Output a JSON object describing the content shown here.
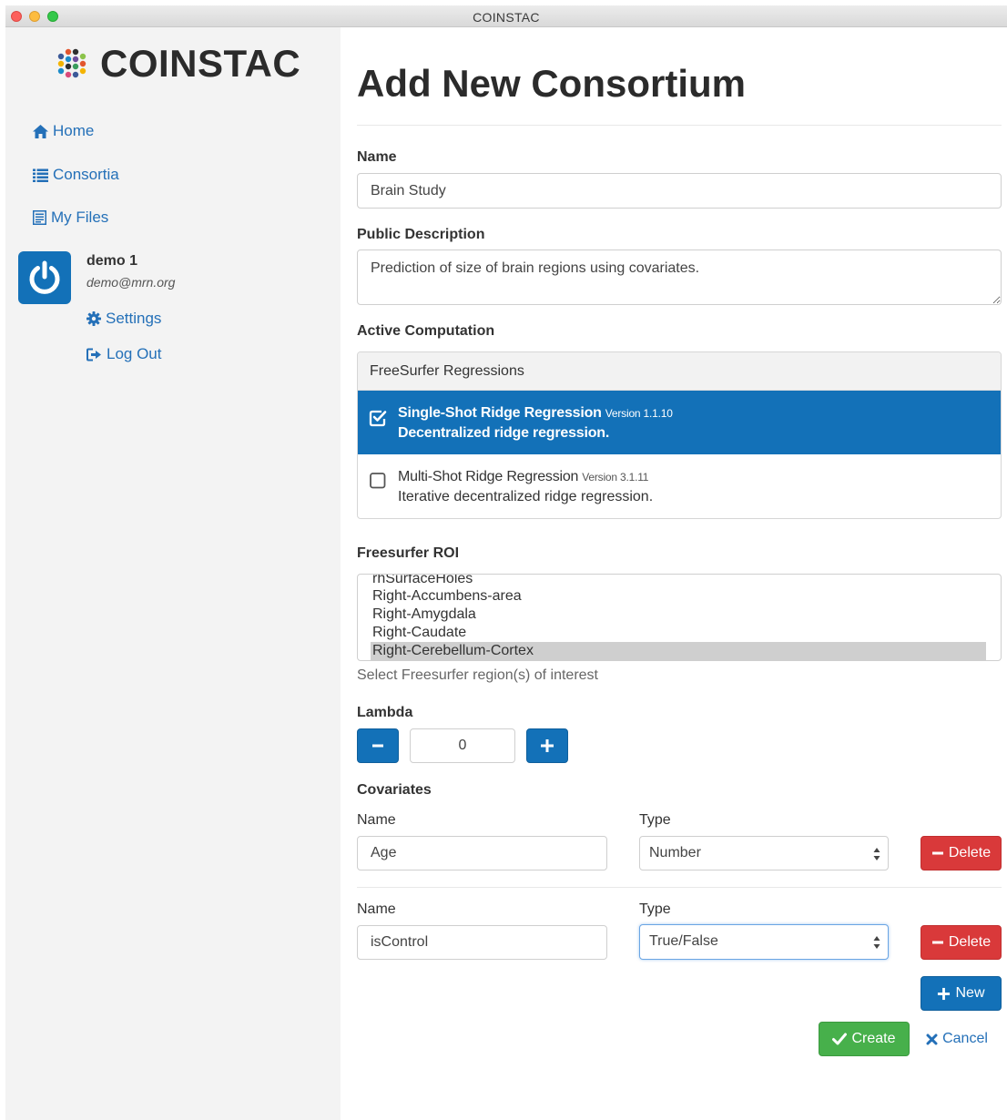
{
  "window": {
    "title": "COINSTAC"
  },
  "sidebar": {
    "brand": "COINSTAC",
    "nav": [
      {
        "label": "Home",
        "icon": "home-icon"
      },
      {
        "label": "Consortia",
        "icon": "list-icon"
      },
      {
        "label": "My Files",
        "icon": "file-icon"
      }
    ],
    "user": {
      "name": "demo 1",
      "email": "demo@mrn.org",
      "settings_label": "Settings",
      "logout_label": "Log Out"
    }
  },
  "main": {
    "title": "Add New Consortium",
    "name_label": "Name",
    "name_value": "Brain Study",
    "desc_label": "Public Description",
    "desc_value": "Prediction of size of brain regions using covariates.",
    "computation_label": "Active Computation",
    "computation_group": "FreeSurfer Regressions",
    "computations": [
      {
        "name": "Single-Shot Ridge Regression",
        "version": "Version 1.1.10",
        "description": "Decentralized ridge regression.",
        "selected": true
      },
      {
        "name": "Multi-Shot Ridge Regression",
        "version": "Version 3.1.11",
        "description": "Iterative decentralized ridge regression.",
        "selected": false
      }
    ],
    "roi_label": "Freesurfer ROI",
    "roi_items": [
      "rhSurfaceHoles",
      "Right-Accumbens-area",
      "Right-Amygdala",
      "Right-Caudate",
      "Right-Cerebellum-Cortex"
    ],
    "roi_selected": "Right-Cerebellum-Cortex",
    "roi_help": "Select Freesurfer region(s) of interest",
    "lambda_label": "Lambda",
    "lambda_value": "0",
    "covariates_label": "Covariates",
    "covariates": [
      {
        "name_label": "Name",
        "type_label": "Type",
        "name_value": "Age",
        "type_value": "Number",
        "delete_label": "Delete"
      },
      {
        "name_label": "Name",
        "type_label": "Type",
        "name_value": "isControl",
        "type_value": "True/False",
        "delete_label": "Delete"
      }
    ],
    "new_label": "New",
    "create_label": "Create",
    "cancel_label": "Cancel"
  },
  "colors": {
    "primary": "#1371b8",
    "danger": "#d9393a",
    "success": "#47b04b",
    "link": "#2470b8",
    "sidebar_bg": "#f3f3f3"
  }
}
